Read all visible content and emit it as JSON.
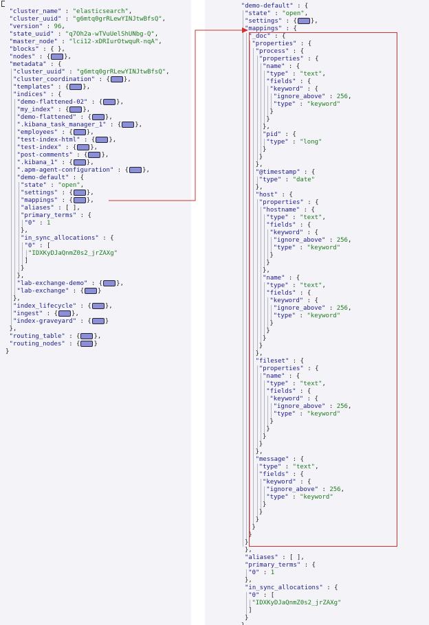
{
  "left": {
    "open": "{",
    "rows": [
      {
        "key": "\"cluster_name\"",
        "sep": " : ",
        "val": "\"elasticsearch\"",
        "tail": ","
      },
      {
        "key": "\"cluster_uuid\"",
        "sep": " : ",
        "val": "\"g6mtq0grRLewYINJtwBfsQ\"",
        "tail": ","
      },
      {
        "key": "\"version\"",
        "sep": " : ",
        "val": "96",
        "tail": ","
      },
      {
        "key": "\"state_uuid\"",
        "sep": " : ",
        "val": "\"q7Oh2a-wTVuUelShUNbg-Q\"",
        "tail": ","
      },
      {
        "key": "\"master_node\"",
        "sep": " : ",
        "val": "\"lci12-xDRIurOtwquR-nqA\"",
        "tail": ","
      },
      {
        "key": "\"blocks\"",
        "sep": " : ",
        "val": "{ }",
        "tail": ","
      },
      {
        "key": "\"nodes\"",
        "sep": " : ",
        "collapsed": true,
        "tail": ","
      },
      {
        "key": "\"metadata\"",
        "sep": " : ",
        "val": "{",
        "tail": ""
      },
      {
        "key": "\"cluster_uuid\"",
        "sep": " : ",
        "val": "\"g6mtq0grRLewYINJtwBfsQ\"",
        "tail": ","
      },
      {
        "key": "\"cluster_coordination\"",
        "sep": " : ",
        "collapsed": true,
        "tail": ","
      },
      {
        "key": "\"templates\"",
        "sep": " : ",
        "collapsed": true,
        "tail": ","
      },
      {
        "key": "\"indices\"",
        "sep": " : ",
        "val": "{",
        "tail": ""
      },
      {
        "key": "\"demo-flattened-02\"",
        "sep": " : ",
        "collapsed": true,
        "tail": ","
      },
      {
        "key": "\"my_index\"",
        "sep": " : ",
        "collapsed": true,
        "tail": ","
      },
      {
        "key": "\"demo-flattened\"",
        "sep": " : ",
        "collapsed": true,
        "tail": ","
      },
      {
        "key": "\".kibana_task_manager_1\"",
        "sep": " : ",
        "collapsed": true,
        "tail": ","
      },
      {
        "key": "\"employees\"",
        "sep": " : ",
        "collapsed": true,
        "tail": ","
      },
      {
        "key": "\"test-index-html\"",
        "sep": " : ",
        "collapsed": true,
        "tail": ","
      },
      {
        "key": "\"test-index\"",
        "sep": " : ",
        "collapsed": true,
        "tail": ","
      },
      {
        "key": "\"post-comments\"",
        "sep": " : ",
        "collapsed": true,
        "tail": ","
      },
      {
        "key": "\".kibana_1\"",
        "sep": " : ",
        "collapsed": true,
        "tail": ","
      },
      {
        "key": "\".apm-agent-configuration\"",
        "sep": " : ",
        "collapsed": true,
        "tail": ","
      },
      {
        "key": "\"demo-default\"",
        "sep": " : ",
        "val": "{",
        "tail": ""
      },
      {
        "key": "\"state\"",
        "sep": " : ",
        "val": "\"open\"",
        "tail": ","
      },
      {
        "key": "\"settings\"",
        "sep": " : ",
        "collapsed": true,
        "tail": ","
      },
      {
        "key": "\"mappings\"",
        "sep": " : ",
        "collapsed": true,
        "tail": ","
      },
      {
        "key": "\"aliases\"",
        "sep": " : ",
        "val": "[ ]",
        "tail": ","
      },
      {
        "key": "\"primary_terms\"",
        "sep": " : ",
        "val": "{",
        "tail": ""
      },
      {
        "key": "\"0\"",
        "sep": " : ",
        "val": "1",
        "tail": ""
      },
      {
        "key": "",
        "sep": "",
        "val": "}",
        "tail": ","
      },
      {
        "key": "\"in_sync_allocations\"",
        "sep": " : ",
        "val": "{",
        "tail": ""
      },
      {
        "key": "\"0\"",
        "sep": " : ",
        "val": "[",
        "tail": ""
      },
      {
        "key": "",
        "sep": "",
        "val": "\"IDXKyDJaQnmZ0s2_jrZAXg\"",
        "tail": ""
      },
      {
        "key": "",
        "sep": "",
        "val": "]",
        "tail": ""
      },
      {
        "key": "",
        "sep": "",
        "val": "}",
        "tail": ""
      },
      {
        "key": "",
        "sep": "",
        "val": "}",
        "tail": ","
      },
      {
        "key": "\"lab-exchange-demo\"",
        "sep": " : ",
        "collapsed": true,
        "tail": ","
      },
      {
        "key": "\"lab-exchange\"",
        "sep": " : ",
        "collapsed": true,
        "tail": ""
      },
      {
        "key": "",
        "sep": "",
        "val": "}",
        "tail": ","
      },
      {
        "key": "\"index_lifecycle\"",
        "sep": " : ",
        "collapsed": true,
        "tail": ","
      },
      {
        "key": "\"ingest\"",
        "sep": " : ",
        "collapsed": true,
        "tail": ","
      },
      {
        "key": "\"index-graveyard\"",
        "sep": " : ",
        "collapsed": true,
        "tail": ""
      },
      {
        "key": "",
        "sep": "",
        "val": "}",
        "tail": ","
      },
      {
        "key": "\"routing_table\"",
        "sep": " : ",
        "collapsed": true,
        "tail": ","
      },
      {
        "key": "\"routing_nodes\"",
        "sep": " : ",
        "collapsed": true,
        "tail": ""
      },
      {
        "key": "",
        "sep": "",
        "val": "}",
        "tail": ""
      }
    ]
  },
  "right": {
    "rows": [
      {
        "key": "\"demo-default\"",
        "sep": " : ",
        "val": "{",
        "tail": ""
      },
      {
        "key": "\"state\"",
        "sep": " : ",
        "val": "\"open\"",
        "tail": ","
      },
      {
        "key": "\"settings\"",
        "sep": " : ",
        "collapsed": true,
        "tail": ","
      },
      {
        "key": "\"mappings\"",
        "sep": " : ",
        "val": "{",
        "tail": ""
      },
      {
        "key": "\"_doc\"",
        "sep": " : ",
        "val": "{",
        "tail": ""
      },
      {
        "key": "\"properties\"",
        "sep": " : ",
        "val": "{",
        "tail": ""
      },
      {
        "key": "\"process\"",
        "sep": " : ",
        "val": "{",
        "tail": ""
      },
      {
        "key": "\"properties\"",
        "sep": " : ",
        "val": "{",
        "tail": ""
      },
      {
        "key": "\"name\"",
        "sep": " : ",
        "val": "{",
        "tail": ""
      },
      {
        "key": "\"type\"",
        "sep": " : ",
        "val": "\"text\"",
        "tail": ","
      },
      {
        "key": "\"fields\"",
        "sep": " : ",
        "val": "{",
        "tail": ""
      },
      {
        "key": "\"keyword\"",
        "sep": " : ",
        "val": "{",
        "tail": ""
      },
      {
        "key": "\"ignore_above\"",
        "sep": " : ",
        "val": "256",
        "tail": ","
      },
      {
        "key": "\"type\"",
        "sep": " : ",
        "val": "\"keyword\"",
        "tail": ""
      },
      {
        "key": "",
        "sep": "",
        "val": "}",
        "tail": ""
      },
      {
        "key": "",
        "sep": "",
        "val": "}",
        "tail": ""
      },
      {
        "key": "",
        "sep": "",
        "val": "}",
        "tail": ","
      },
      {
        "key": "\"pid\"",
        "sep": " : ",
        "val": "{",
        "tail": ""
      },
      {
        "key": "\"type\"",
        "sep": " : ",
        "val": "\"long\"",
        "tail": ""
      },
      {
        "key": "",
        "sep": "",
        "val": "}",
        "tail": ""
      },
      {
        "key": "",
        "sep": "",
        "val": "}",
        "tail": ""
      },
      {
        "key": "",
        "sep": "",
        "val": "}",
        "tail": ","
      },
      {
        "key": "\"@timestamp\"",
        "sep": " : ",
        "val": "{",
        "tail": ""
      },
      {
        "key": "\"type\"",
        "sep": " : ",
        "val": "\"date\"",
        "tail": ""
      },
      {
        "key": "",
        "sep": "",
        "val": "}",
        "tail": ","
      },
      {
        "key": "\"host\"",
        "sep": " : ",
        "val": "{",
        "tail": ""
      },
      {
        "key": "\"properties\"",
        "sep": " : ",
        "val": "{",
        "tail": ""
      },
      {
        "key": "\"hostname\"",
        "sep": " : ",
        "val": "{",
        "tail": ""
      },
      {
        "key": "\"type\"",
        "sep": " : ",
        "val": "\"text\"",
        "tail": ","
      },
      {
        "key": "\"fields\"",
        "sep": " : ",
        "val": "{",
        "tail": ""
      },
      {
        "key": "\"keyword\"",
        "sep": " : ",
        "val": "{",
        "tail": ""
      },
      {
        "key": "\"ignore_above\"",
        "sep": " : ",
        "val": "256",
        "tail": ","
      },
      {
        "key": "\"type\"",
        "sep": " : ",
        "val": "\"keyword\"",
        "tail": ""
      },
      {
        "key": "",
        "sep": "",
        "val": "}",
        "tail": ""
      },
      {
        "key": "",
        "sep": "",
        "val": "}",
        "tail": ""
      },
      {
        "key": "",
        "sep": "",
        "val": "}",
        "tail": ","
      },
      {
        "key": "\"name\"",
        "sep": " : ",
        "val": "{",
        "tail": ""
      },
      {
        "key": "\"type\"",
        "sep": " : ",
        "val": "\"text\"",
        "tail": ","
      },
      {
        "key": "\"fields\"",
        "sep": " : ",
        "val": "{",
        "tail": ""
      },
      {
        "key": "\"keyword\"",
        "sep": " : ",
        "val": "{",
        "tail": ""
      },
      {
        "key": "\"ignore_above\"",
        "sep": " : ",
        "val": "256",
        "tail": ","
      },
      {
        "key": "\"type\"",
        "sep": " : ",
        "val": "\"keyword\"",
        "tail": ""
      },
      {
        "key": "",
        "sep": "",
        "val": "}",
        "tail": ""
      },
      {
        "key": "",
        "sep": "",
        "val": "}",
        "tail": ""
      },
      {
        "key": "",
        "sep": "",
        "val": "}",
        "tail": ""
      },
      {
        "key": "",
        "sep": "",
        "val": "}",
        "tail": ""
      },
      {
        "key": "",
        "sep": "",
        "val": "}",
        "tail": ","
      },
      {
        "key": "\"fileset\"",
        "sep": " : ",
        "val": "{",
        "tail": ""
      },
      {
        "key": "\"properties\"",
        "sep": " : ",
        "val": "{",
        "tail": ""
      },
      {
        "key": "\"name\"",
        "sep": " : ",
        "val": "{",
        "tail": ""
      },
      {
        "key": "\"type\"",
        "sep": " : ",
        "val": "\"text\"",
        "tail": ","
      },
      {
        "key": "\"fields\"",
        "sep": " : ",
        "val": "{",
        "tail": ""
      },
      {
        "key": "\"keyword\"",
        "sep": " : ",
        "val": "{",
        "tail": ""
      },
      {
        "key": "\"ignore_above\"",
        "sep": " : ",
        "val": "256",
        "tail": ","
      },
      {
        "key": "\"type\"",
        "sep": " : ",
        "val": "\"keyword\"",
        "tail": ""
      },
      {
        "key": "",
        "sep": "",
        "val": "}",
        "tail": ""
      },
      {
        "key": "",
        "sep": "",
        "val": "}",
        "tail": ""
      },
      {
        "key": "",
        "sep": "",
        "val": "}",
        "tail": ""
      },
      {
        "key": "",
        "sep": "",
        "val": "}",
        "tail": ""
      },
      {
        "key": "",
        "sep": "",
        "val": "}",
        "tail": ","
      },
      {
        "key": "\"message\"",
        "sep": " : ",
        "val": "{",
        "tail": ""
      },
      {
        "key": "\"type\"",
        "sep": " : ",
        "val": "\"text\"",
        "tail": ","
      },
      {
        "key": "\"fields\"",
        "sep": " : ",
        "val": "{",
        "tail": ""
      },
      {
        "key": "\"keyword\"",
        "sep": " : ",
        "val": "{",
        "tail": ""
      },
      {
        "key": "\"ignore_above\"",
        "sep": " : ",
        "val": "256",
        "tail": ","
      },
      {
        "key": "\"type\"",
        "sep": " : ",
        "val": "\"keyword\"",
        "tail": ""
      },
      {
        "key": "",
        "sep": "",
        "val": "}",
        "tail": ""
      },
      {
        "key": "",
        "sep": "",
        "val": "}",
        "tail": ""
      },
      {
        "key": "",
        "sep": "",
        "val": "}",
        "tail": ""
      },
      {
        "key": "",
        "sep": "",
        "val": "}",
        "tail": ""
      },
      {
        "key": "",
        "sep": "",
        "val": "}",
        "tail": ""
      },
      {
        "key": "",
        "sep": "",
        "val": "}",
        "tail": ""
      },
      {
        "key": "",
        "sep": "",
        "val": "}",
        "tail": ","
      },
      {
        "key": "\"aliases\"",
        "sep": " : ",
        "val": "[ ]",
        "tail": ","
      },
      {
        "key": "\"primary_terms\"",
        "sep": " : ",
        "val": "{",
        "tail": ""
      },
      {
        "key": "\"0\"",
        "sep": " : ",
        "val": "1",
        "tail": ""
      },
      {
        "key": "",
        "sep": "",
        "val": "}",
        "tail": ","
      },
      {
        "key": "\"in_sync_allocations\"",
        "sep": " : ",
        "val": "{",
        "tail": ""
      },
      {
        "key": "\"0\"",
        "sep": " : ",
        "val": "[",
        "tail": ""
      },
      {
        "key": "",
        "sep": "",
        "val": "\"IDXKyDJaQnmZ0s2_jrZAXg\"",
        "tail": ""
      },
      {
        "key": "",
        "sep": "",
        "val": "]",
        "tail": ""
      },
      {
        "key": "",
        "sep": "",
        "val": "}",
        "tail": ""
      },
      {
        "key": "",
        "sep": "",
        "val": "}",
        "tail": ","
      }
    ]
  },
  "colors": {
    "key": "#1a1a8a",
    "string": "#1d7a1d",
    "highlight": "#d23030",
    "collapsed": "#8b8fd8"
  },
  "icons": {
    "collapsed": "collapsed-object-icon",
    "arrow": "arrow-icon"
  }
}
